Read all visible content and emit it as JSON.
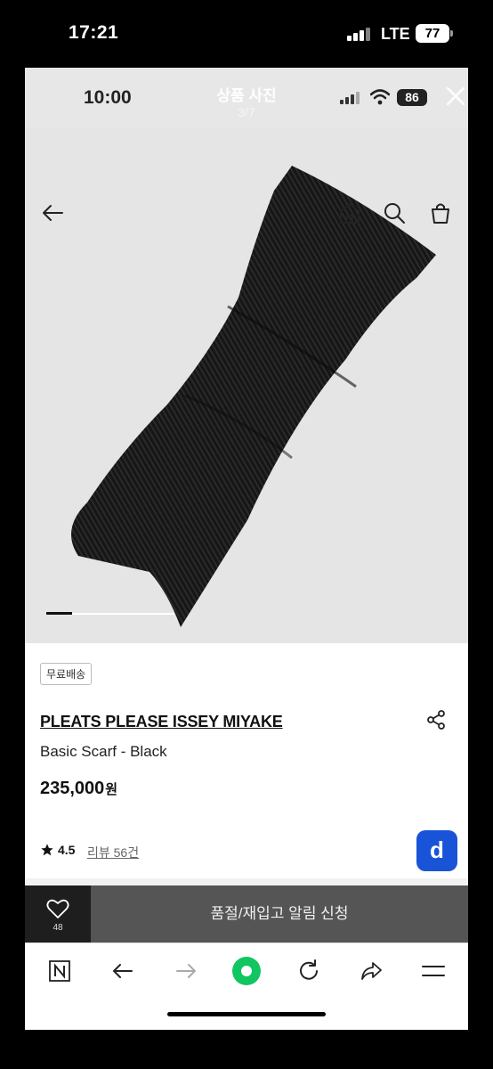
{
  "outer_status": {
    "time": "17:21",
    "network": "LTE",
    "battery": "77"
  },
  "viewer": {
    "time": "10:00",
    "title": "상품 사진",
    "counter": "3/7",
    "battery": "86"
  },
  "product": {
    "shipping_badge": "무료배송",
    "brand": "PLEATS PLEASE ISSEY MIYAKE",
    "name": "Basic Scarf - Black",
    "price": "235,000",
    "currency": "원",
    "rating": "4.5",
    "review_label": "리뷰 56건",
    "image_description_icon": "product-photo",
    "slide_progress": 0.2
  },
  "actions": {
    "wishlist_count": "48",
    "restock_label": "품절/재입고 알림 신청",
    "d_badge": "d"
  },
  "colors": {
    "restock_bg": "#555555",
    "wish_bg": "#1e1e1e",
    "d_badge": "#1954d8"
  }
}
